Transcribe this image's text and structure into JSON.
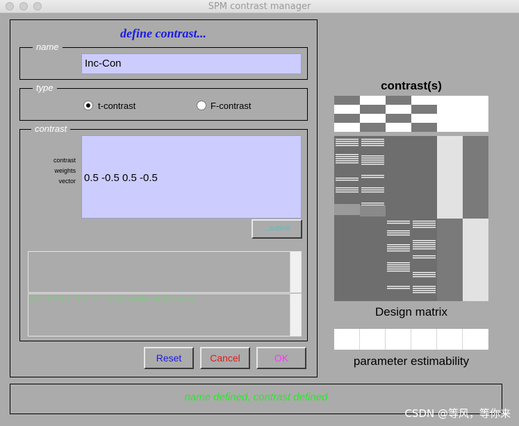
{
  "window": {
    "title": "SPM contrast manager"
  },
  "panel": {
    "heading": "define contrast..."
  },
  "name_group": {
    "legend": "name",
    "value": "Inc-Con"
  },
  "type_group": {
    "legend": "type",
    "options": [
      {
        "label": "t-contrast",
        "selected": true
      },
      {
        "label": "F-contrast",
        "selected": false
      }
    ]
  },
  "contrast_group": {
    "legend": "contrast",
    "side_labels": [
      "contrast",
      "weights",
      "vector"
    ],
    "vector_value": "0.5 -0.5 0.5 -0.5",
    "submit_label": "...submit",
    "parse_output": "0.5 -0.5 0.5 -0.5  <-  [right padded with 2 zeros]"
  },
  "buttons": {
    "reset": "Reset",
    "cancel": "Cancel",
    "ok": "OK"
  },
  "colors": {
    "reset": "#1a1ae6",
    "cancel": "#e61a1a",
    "ok": "#ff33ff"
  },
  "status": {
    "message": "name defined, contrast defined"
  },
  "right_panel": {
    "contrasts_heading": "contrast(s)",
    "design_matrix_label": "Design matrix",
    "estimability_label": "parameter estimability",
    "n_columns": 6,
    "contrast_rows": [
      [
        0.5,
        -0.5,
        0.5,
        -0.5,
        0,
        0
      ],
      [
        0.5,
        -0.5,
        0.5,
        -0.5,
        0,
        0
      ]
    ]
  },
  "watermark": {
    "text": "CSDN @等风，等你来"
  }
}
